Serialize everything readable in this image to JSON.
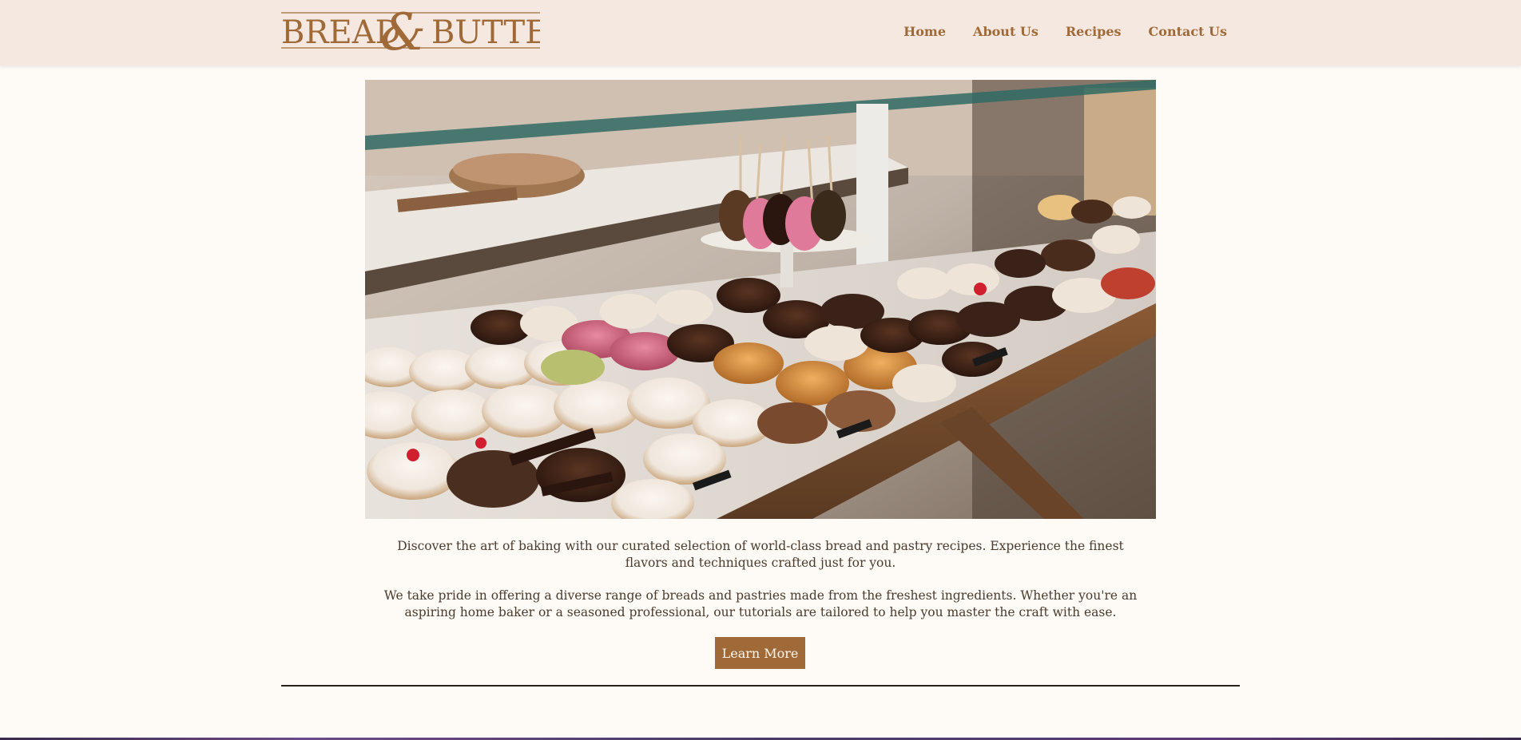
{
  "brand": {
    "logo_text_left": "BREAD",
    "logo_ampersand": "&",
    "logo_text_right": "BUTTER",
    "color": "#a06a38"
  },
  "nav": {
    "items": [
      {
        "label": "Home"
      },
      {
        "label": "About Us"
      },
      {
        "label": "Recipes"
      },
      {
        "label": "Contact Us"
      }
    ]
  },
  "hero": {
    "image": "pastry-display-case-photo"
  },
  "intro": {
    "paragraph_1": "Discover the art of baking with our curated selection of world-class bread and pastry recipes. Experience the finest flavors and techniques crafted just for you.",
    "paragraph_2": "We take pride in offering a diverse range of breads and pastries made from the freshest ingredients. Whether you're an aspiring home baker or a seasoned professional, our tutorials are tailored to help you master the craft with ease."
  },
  "cta": {
    "label": "Learn More",
    "color": "#a06a38"
  },
  "colors": {
    "header_bg": "#f5e8e0",
    "page_bg": "#fefaf5",
    "text": "#4a3b2d",
    "accent": "#a06a38"
  }
}
